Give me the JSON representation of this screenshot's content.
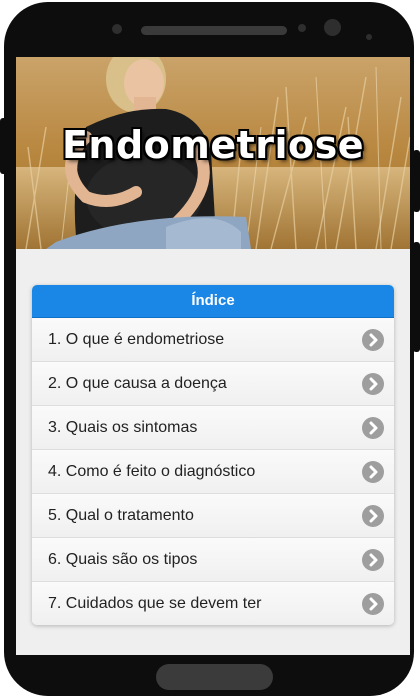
{
  "banner": {
    "title": "Endometriose",
    "image": "pregnant-woman-in-wheat-field"
  },
  "index": {
    "header": "Índice",
    "items": [
      {
        "label": "1. O que é endometriose"
      },
      {
        "label": "2. O que causa a doença"
      },
      {
        "label": "3. Quais os sintomas"
      },
      {
        "label": "4. Como é feito o diagnóstico"
      },
      {
        "label": "5. Qual o tratamento"
      },
      {
        "label": "6. Quais são os tipos"
      },
      {
        "label": "7. Cuidados que se devem ter"
      }
    ],
    "item_icon": "chevron-right-circle-icon"
  },
  "colors": {
    "header_blue": "#1a87e6",
    "chevron_gray": "#9e9e9e",
    "phone_body": "#0d0d0d"
  }
}
